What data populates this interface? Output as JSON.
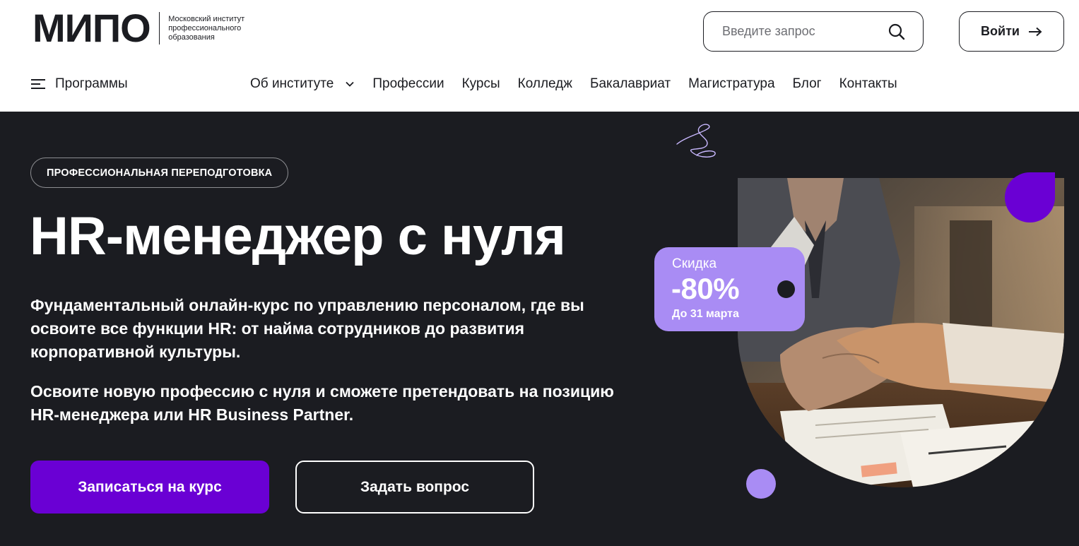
{
  "header": {
    "logo_mark": "МИПО",
    "logo_text_lines": [
      "Московский институт",
      "профессионального",
      "образования"
    ],
    "search_placeholder": "Введите запрос",
    "login_label": "Войти"
  },
  "nav": {
    "programs_label": "Программы",
    "links": [
      "Об институте",
      "Профессии",
      "Курсы",
      "Колледж",
      "Бакалавриат",
      "Магистратура",
      "Блог",
      "Контакты"
    ]
  },
  "hero": {
    "badge": "ПРОФЕССИОНАЛЬНАЯ ПЕРЕПОДГОТОВКА",
    "title": "HR-менеджер с нуля",
    "description": "Фундаментальный онлайн-курс по управлению персоналом, где вы освоите все функции HR: от найма сотрудников до развития корпоративной культуры.",
    "description2": "Освоите новую профессию с нуля и сможете претендовать на позицию HR-менеджера или HR Business Partner.",
    "primary_button": "Записаться на курс",
    "secondary_button": "Задать вопрос",
    "discount": {
      "label": "Скидка",
      "value": "-80%",
      "until": "До 31 марта"
    }
  },
  "colors": {
    "dark_bg": "#1b1c21",
    "accent_purple": "#6a00d4",
    "lilac": "#a98cf4"
  }
}
